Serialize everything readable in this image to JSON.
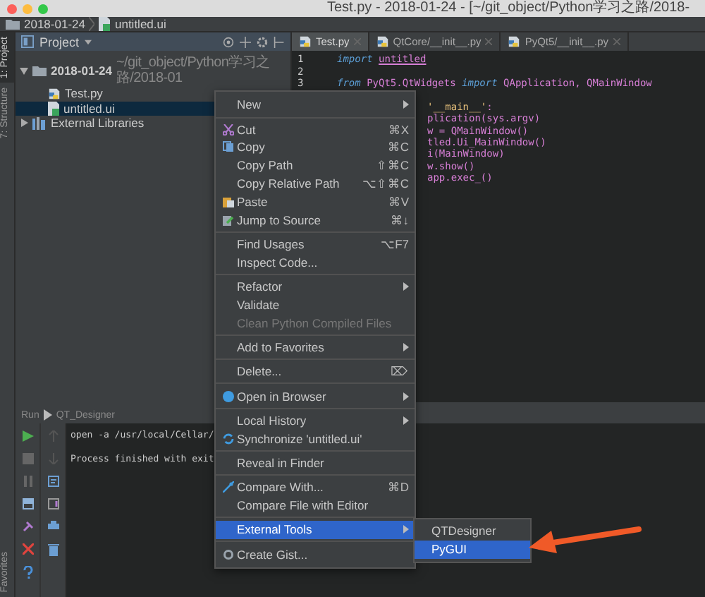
{
  "window": {
    "title": "Test.py - 2018-01-24 - [~/git_object/Python学习之路/2018-"
  },
  "breadcrumb": [
    "2018-01-24",
    "untitled.ui"
  ],
  "sidebar_tabs": [
    {
      "label": "1: Project",
      "selected": true
    },
    {
      "label": "7: Structure",
      "selected": false
    },
    {
      "label": "Favorites",
      "selected": false
    }
  ],
  "project_panel": {
    "title": "Project",
    "tree": [
      {
        "label": "2018-01-24",
        "path": "~/git_object/Python学习之路/2018-01",
        "kind": "folder",
        "expanded": true,
        "selected": false,
        "children": [
          {
            "label": "Test.py",
            "kind": "python",
            "selected": false
          },
          {
            "label": "untitled.ui",
            "kind": "ui",
            "selected": true
          }
        ]
      },
      {
        "label": "External Libraries",
        "kind": "library",
        "expanded": false,
        "selected": false
      }
    ]
  },
  "editor": {
    "tabs": [
      {
        "label": "Test.py",
        "selected": true
      },
      {
        "label": "QtCore/__init__.py",
        "selected": false
      },
      {
        "label": "PyQt5/__init__.py",
        "selected": false
      }
    ],
    "lines": [
      {
        "number": "1",
        "tokens": [
          {
            "text": "import ",
            "kind": "keyword"
          },
          {
            "text": "untitled",
            "kind": "unresolved"
          }
        ]
      },
      {
        "number": "2"
      },
      {
        "number": "3",
        "tokens": [
          {
            "text": "from ",
            "kind": "keyword"
          },
          {
            "text": "PyQt5.QtWidgets ",
            "kind": "plain"
          },
          {
            "text": "import ",
            "kind": "keyword"
          },
          {
            "text": "QApplication, QMainWindow",
            "kind": "plain"
          }
        ]
      }
    ],
    "covered_lines": [
      {
        "tokens": [
          {
            "text": "'__main__'",
            "kind": "string"
          },
          {
            "text": ":",
            "kind": "plain"
          }
        ]
      },
      {
        "tokens": [
          {
            "text": "plication(sys.argv)",
            "kind": "plain"
          }
        ]
      },
      {
        "tokens": [
          {
            "text": "w = QMainWindow()",
            "kind": "plain"
          }
        ]
      },
      {
        "tokens": [
          {
            "text": "tled.Ui_MainWindow()",
            "kind": "plain"
          }
        ]
      },
      {
        "tokens": [
          {
            "text": "i(MainWindow)",
            "kind": "plain"
          }
        ]
      },
      {
        "tokens": [
          {
            "text": "w.show()",
            "kind": "plain"
          }
        ]
      },
      {
        "tokens": [
          {
            "text": "app.exec_()",
            "kind": "plain"
          }
        ]
      }
    ]
  },
  "run_panel": {
    "label": "Run",
    "config": "QT_Designer",
    "output": [
      "open -a /usr/local/Cellar/",
      "Process finished with exit"
    ]
  },
  "context_menu": {
    "sections": [
      [
        {
          "label": "New",
          "submenu": true,
          "disabled": false,
          "selected": false
        }
      ],
      [
        {
          "label": "Cut",
          "shortcut": "⌘X",
          "submenu": false,
          "disabled": false,
          "selected": false
        },
        {
          "label": "Copy",
          "shortcut": "⌘C",
          "submenu": false,
          "disabled": false,
          "selected": false
        },
        {
          "label": "Copy Path",
          "shortcut": "⇧⌘C",
          "submenu": false,
          "disabled": false,
          "selected": false
        },
        {
          "label": "Copy Relative Path",
          "shortcut": "⌥⇧⌘C",
          "submenu": false,
          "disabled": false,
          "selected": false
        },
        {
          "label": "Paste",
          "shortcut": "⌘V",
          "submenu": false,
          "disabled": false,
          "selected": false
        },
        {
          "label": "Jump to Source",
          "shortcut": "⌘↓",
          "submenu": false,
          "disabled": false,
          "selected": false
        }
      ],
      [
        {
          "label": "Find Usages",
          "shortcut": "⌥F7",
          "submenu": false,
          "disabled": false,
          "selected": false
        },
        {
          "label": "Inspect Code...",
          "submenu": false,
          "disabled": false,
          "selected": false
        }
      ],
      [
        {
          "label": "Refactor",
          "submenu": true,
          "disabled": false,
          "selected": false
        },
        {
          "label": "Validate",
          "submenu": false,
          "disabled": false,
          "selected": false
        },
        {
          "label": "Clean Python Compiled Files",
          "submenu": false,
          "disabled": true,
          "selected": false
        }
      ],
      [
        {
          "label": "Add to Favorites",
          "submenu": true,
          "disabled": false,
          "selected": false
        }
      ],
      [
        {
          "label": "Delete...",
          "shortcut": "⌦",
          "submenu": false,
          "disabled": false,
          "selected": false
        }
      ],
      [
        {
          "label": "Open in Browser",
          "submenu": true,
          "disabled": false,
          "selected": false
        }
      ],
      [
        {
          "label": "Local History",
          "submenu": true,
          "disabled": false,
          "selected": false
        },
        {
          "label": "Synchronize 'untitled.ui'",
          "submenu": false,
          "disabled": false,
          "selected": false
        }
      ],
      [
        {
          "label": "Reveal in Finder",
          "submenu": false,
          "disabled": false,
          "selected": false
        }
      ],
      [
        {
          "label": "Compare With...",
          "shortcut": "⌘D",
          "submenu": false,
          "disabled": false,
          "selected": false
        },
        {
          "label": "Compare File with Editor",
          "submenu": false,
          "disabled": false,
          "selected": false
        }
      ],
      [
        {
          "label": "External Tools",
          "submenu": true,
          "disabled": false,
          "selected": true
        }
      ],
      [
        {
          "label": "Create Gist...",
          "submenu": false,
          "disabled": false,
          "selected": false
        }
      ]
    ]
  },
  "submenu": {
    "items": [
      {
        "label": "QTDesigner",
        "selected": false
      },
      {
        "label": "PyGUI",
        "selected": true
      }
    ]
  }
}
